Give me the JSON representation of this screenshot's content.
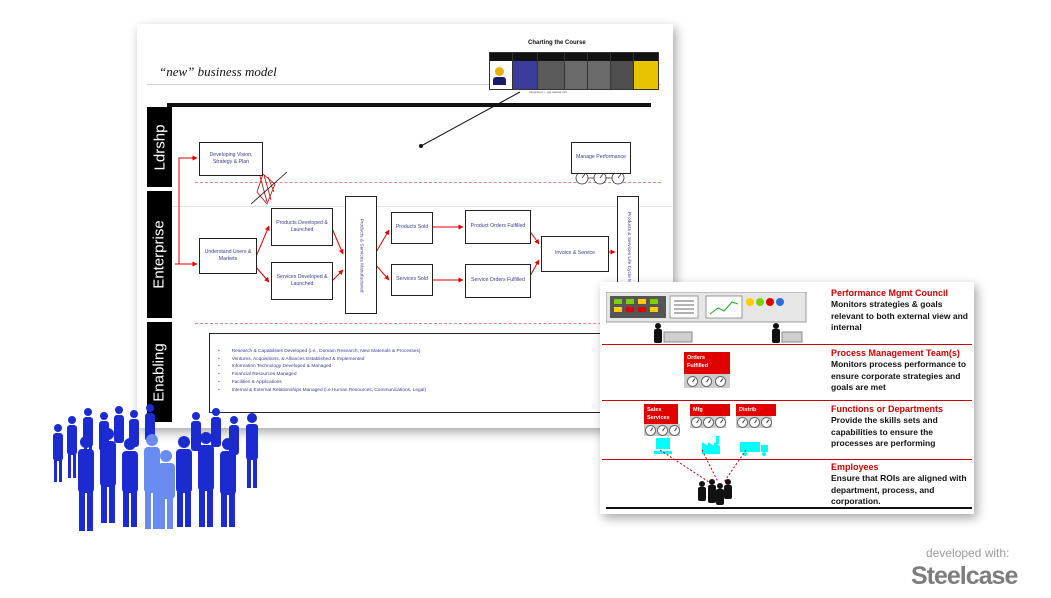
{
  "slide": {
    "title": "“new” business model",
    "strip": {
      "title": "Charting the Course",
      "columns": [
        "",
        "",
        "",
        "",
        "",
        "",
        ""
      ],
      "caption": "Integrated — get started cell"
    },
    "bands": {
      "leadership": "Ldrshp",
      "enterprise": "Enterprise",
      "enabling": "Enabling"
    },
    "boxes": {
      "vision": "Developing Vision, Strategy & Plan",
      "manage": "Manage Performance",
      "understand": "Understand Users & Markets",
      "products_dev": "Products Developed & Launched",
      "services_dev": "Services Developed & Launched",
      "manufactured": "Products & Services Manufactured",
      "products_sold": "Products Sold",
      "services_sold": "Services Sold",
      "product_orders": "Product Orders Fulfilled",
      "service_orders": "Service Orders Fulfilled",
      "invoice": "Invoice & Service",
      "lifecycle": "Products & Services Life Cycle Managed"
    },
    "enabling_items": [
      "Research & Capabilities Developed (i.e., Domain Research; New Materials & Processes)",
      "Ventures, Acquisitions, & Alliances Established & Implemented",
      "Information Technology Developed & Managed",
      "Financial Resources Managed",
      "Facilities & Applications",
      "Internal & External Relationships Managed (i.e.Human Resources, Communications, Legal)"
    ]
  },
  "front": {
    "sections": [
      {
        "title": "Performance Mgmt Council",
        "desc": "Monitors strategies & goals relevant to both external view and internal"
      },
      {
        "title": "Process Management Team(s)",
        "desc": "Monitors process performance to ensure corporate strategies and goals are met"
      },
      {
        "title": "Functions or Departments",
        "desc": "Provide the skills sets and capabilities to ensure the processes are performing"
      },
      {
        "title": "Employees",
        "desc": "Ensure that ROIs are aligned with department, process, and corporation."
      }
    ],
    "orders_label": "Orders Fulfilled",
    "departments": [
      "Sales Services",
      "Mfg",
      "Distrib"
    ]
  },
  "watermark": {
    "developed": "developed with:",
    "brand": "Steelcase"
  },
  "colors": {
    "accent_red": "#e00000",
    "diagram_blue": "#3b3b8f",
    "people_blue": "#1b2bd0",
    "cyan": "#00ffff"
  }
}
